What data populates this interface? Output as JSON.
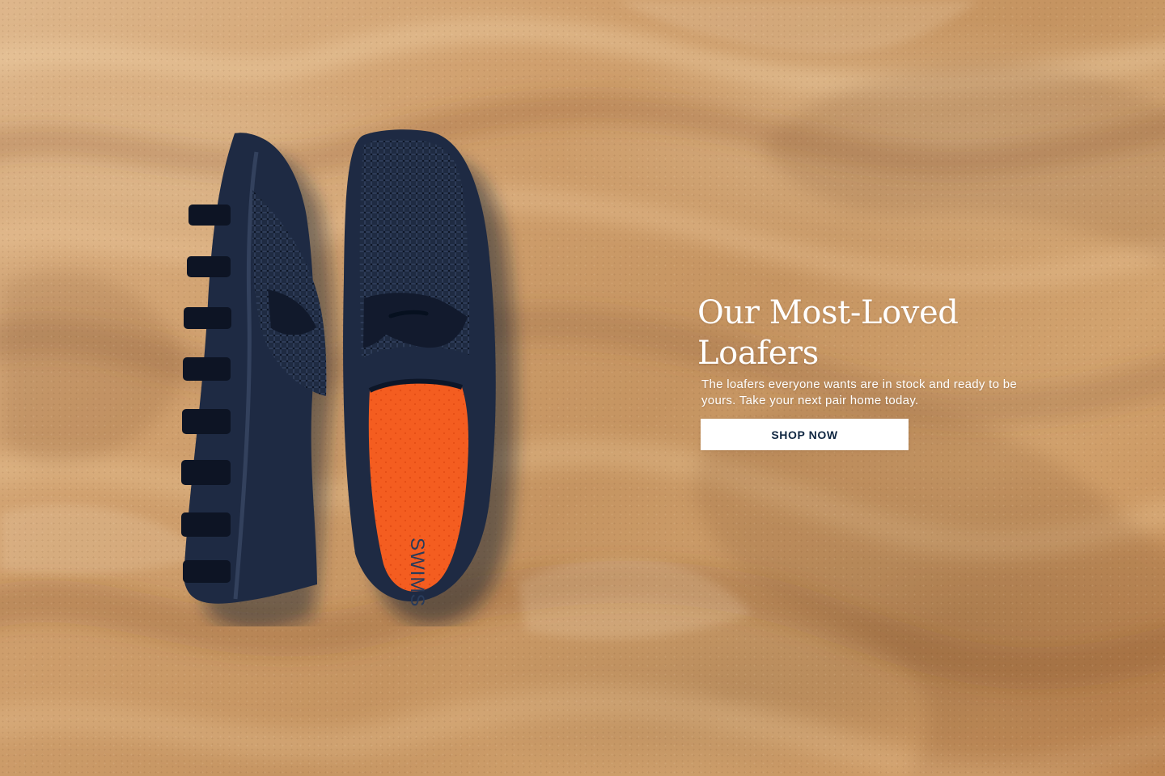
{
  "hero": {
    "title": "Our Most-Loved Loafers",
    "description": "The loafers everyone wants are in stock and ready to be yours. Take your next pair home today.",
    "cta_label": "SHOP NOW",
    "insole_logo": "SWIMS",
    "colors": {
      "sand": "#d0a06e",
      "shoe_navy": "#1e2a43",
      "insole_orange": "#f45d20",
      "button_text": "#0f2641"
    }
  }
}
